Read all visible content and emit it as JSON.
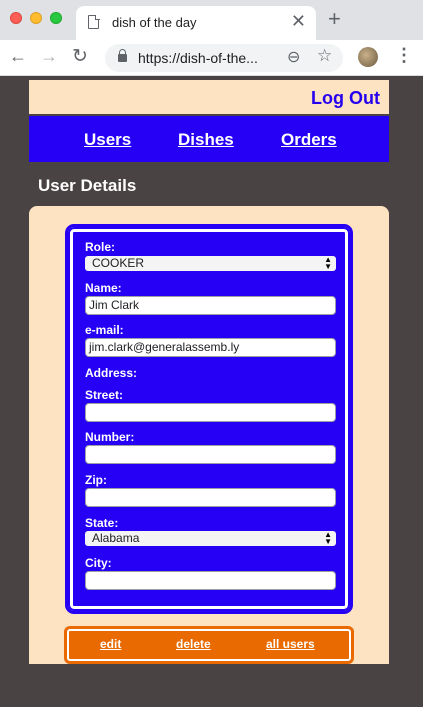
{
  "browser": {
    "tab_title": "dish of the day",
    "url": "https://dish-of-the...",
    "close_glyph": "✕",
    "new_tab_glyph": "+",
    "back_glyph": "←",
    "forward_glyph": "→",
    "reload_glyph": "↻",
    "zoom_glyph": "⊖",
    "star_glyph": "☆",
    "menu_glyph": "⋮"
  },
  "header": {
    "logout_label": "Log Out"
  },
  "nav": {
    "users": "Users",
    "dishes": "Dishes",
    "orders": "Orders"
  },
  "page": {
    "heading": "User Details"
  },
  "form": {
    "role_label": "Role:",
    "role_value": "COOKER",
    "name_label": "Name:",
    "name_value": "Jim Clark",
    "email_label": "e-mail:",
    "email_value": "jim.clark@generalassemb.ly",
    "address_label": "Address:",
    "street_label": "Street:",
    "street_value": "",
    "number_label": "Number:",
    "number_value": "",
    "zip_label": "Zip:",
    "zip_value": "",
    "state_label": "State:",
    "state_value": "Alabama",
    "city_label": "City:",
    "city_value": ""
  },
  "actions": {
    "edit": "edit",
    "delete": "delete",
    "all_users": "all users"
  },
  "colors": {
    "accent_blue": "#2600f5",
    "cream": "#fde3c2",
    "orange": "#e86a00",
    "background": "#4a4344"
  }
}
